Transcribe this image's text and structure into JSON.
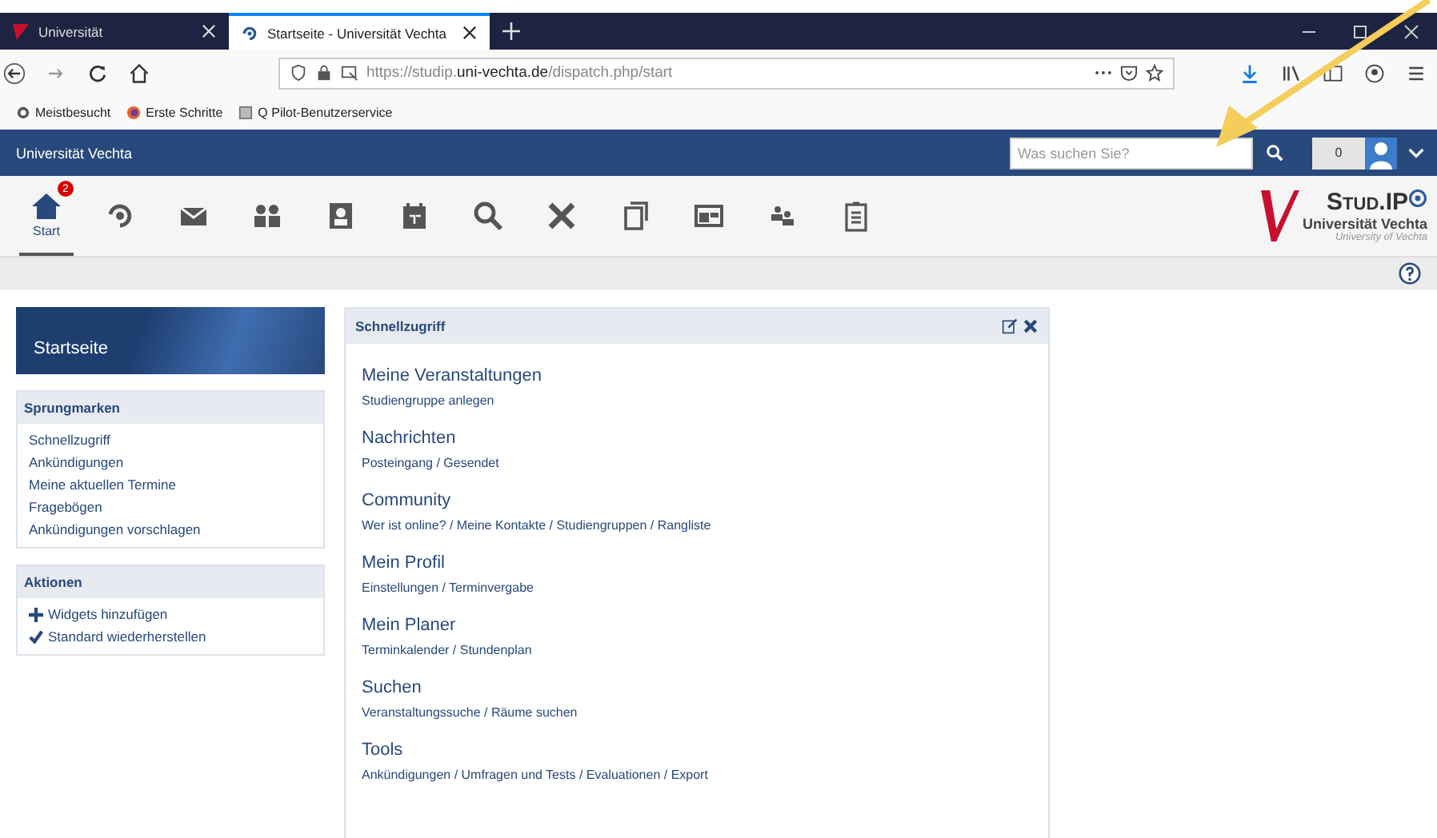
{
  "browser": {
    "tabs": [
      {
        "title": "Universität",
        "selected": false
      },
      {
        "title": "Startseite - Universität Vechta",
        "selected": true
      }
    ],
    "url": {
      "prefix": "https://studip.",
      "domain": "uni-vechta.de",
      "path": "/dispatch.php/start"
    },
    "bookmarks": [
      "Meistbesucht",
      "Erste Schritte",
      "Q Pilot-Benutzerservice"
    ]
  },
  "header": {
    "title": "Universität Vechta",
    "search": {
      "placeholder": "Was suchen Sie?"
    },
    "notifications": "0"
  },
  "nav": [
    {
      "label": "Start",
      "badge": "2",
      "selected": true
    },
    {
      "selected": false
    },
    {
      "selected": false
    },
    {
      "selected": false
    },
    {
      "selected": false
    },
    {
      "selected": false
    },
    {
      "selected": false
    },
    {
      "selected": false
    },
    {
      "selected": false
    },
    {
      "selected": false
    },
    {
      "selected": false
    },
    {
      "selected": false
    }
  ],
  "logo": {
    "name": "Stud.IP",
    "university": "Universität Vechta",
    "subtitle": "University of Vechta"
  },
  "sidebar": {
    "title": "Startseite",
    "sections": [
      {
        "title": "Sprungmarken",
        "items": [
          {
            "label": "Schnellzugriff"
          },
          {
            "label": "Ankündigungen"
          },
          {
            "label": "Meine aktuellen Termine"
          },
          {
            "label": "Fragebögen"
          },
          {
            "label": "Ankündigungen vorschlagen"
          }
        ]
      },
      {
        "title": "Aktionen",
        "items": [
          {
            "label": "Widgets hinzufügen",
            "kind": "add"
          },
          {
            "label": "Standard wiederherstellen",
            "kind": "reset"
          }
        ]
      }
    ]
  },
  "widget": {
    "title": "Schnellzugriff",
    "entries": [
      {
        "title": "Meine Veranstaltungen",
        "links": "Studiengruppe anlegen"
      },
      {
        "title": "Nachrichten",
        "links": "Posteingang / Gesendet"
      },
      {
        "title": "Community",
        "links": "Wer ist online? / Meine Kontakte / Studiengruppen / Rangliste"
      },
      {
        "title": "Mein Profil",
        "links": "Einstellungen / Terminvergabe"
      },
      {
        "title": "Mein Planer",
        "links": "Terminkalender / Stundenplan"
      },
      {
        "title": "Suchen",
        "links": "Veranstaltungssuche / Räume suchen"
      },
      {
        "title": "Tools",
        "links": "Ankündigungen / Umfragen und Tests / Evaluationen / Export"
      }
    ]
  }
}
